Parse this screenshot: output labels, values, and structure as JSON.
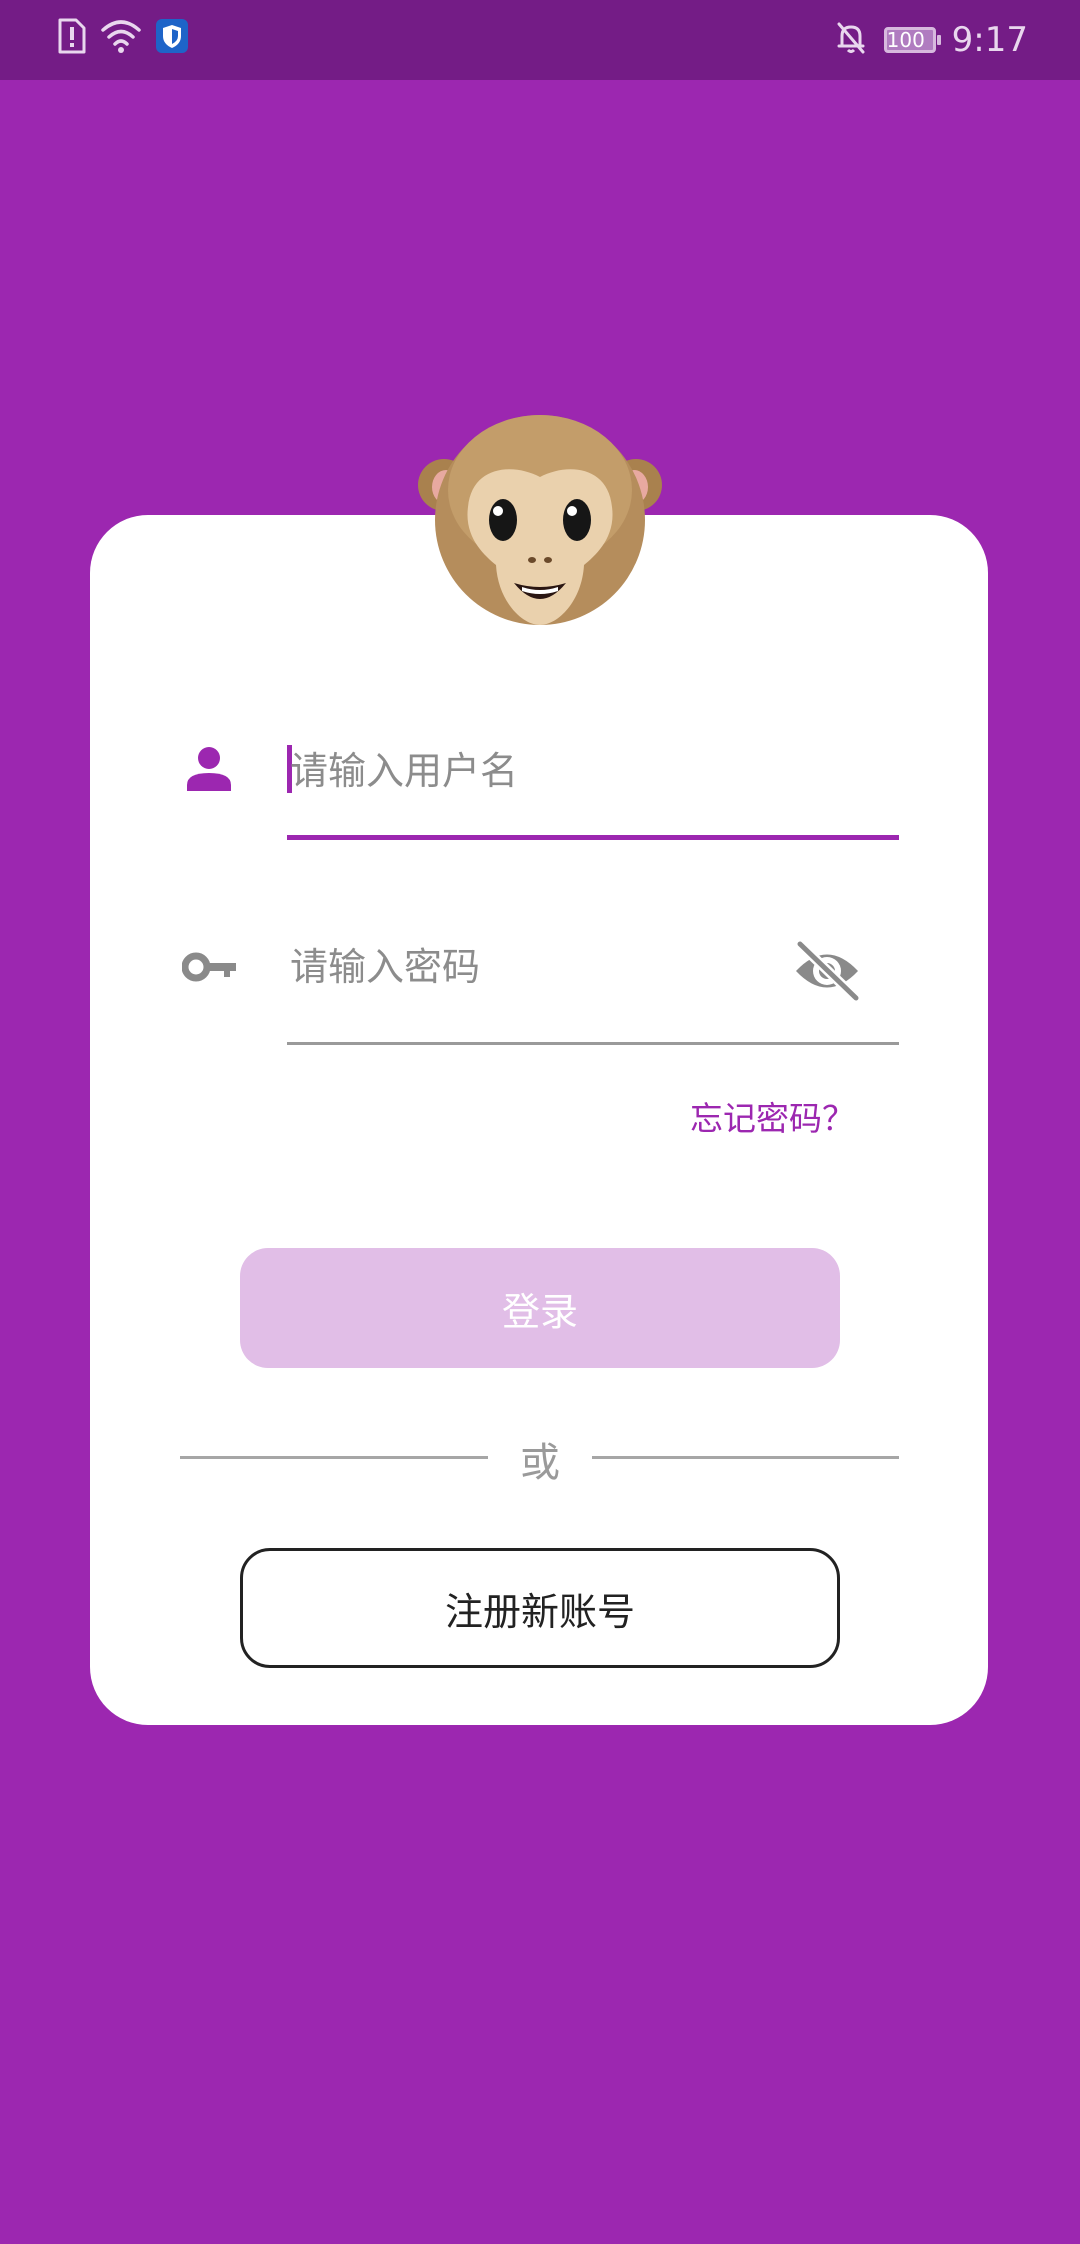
{
  "status_bar": {
    "time": "9:17",
    "battery_level": "100",
    "icons": [
      "sim-alert-icon",
      "wifi-icon",
      "shield-icon",
      "bell-off-icon",
      "battery-icon"
    ]
  },
  "colors": {
    "primary": "#9c27b0",
    "status_bar": "#741c86",
    "login_button_disabled": "#e1bee7",
    "card": "#ffffff"
  },
  "login": {
    "avatar_icon": "monkey-face-icon",
    "username": {
      "icon": "person-icon",
      "placeholder": "请输入用户名",
      "value": ""
    },
    "password": {
      "icon": "key-icon",
      "placeholder": "请输入密码",
      "value": "",
      "toggle_icon": "eye-off-icon"
    },
    "forgot_label": "忘记密码？",
    "login_label": "登录",
    "or_label": "或",
    "register_label": "注册新账号"
  }
}
